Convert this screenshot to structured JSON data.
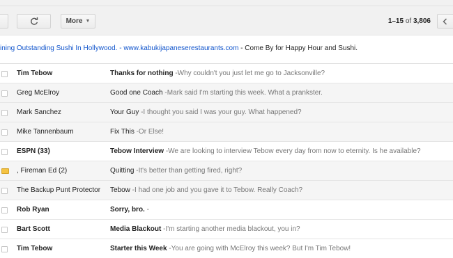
{
  "toolbar": {
    "more_label": "More",
    "pager_range": "1–15",
    "pager_of": " of ",
    "pager_total": "3,806"
  },
  "ad": {
    "text_link": "ining Outstanding Sushi In Hollywood. - www.kabukijapaneserestaurants.com",
    "text_tail": " - Come By for Happy Hour and Sushi."
  },
  "emails": [
    {
      "sender": "Tim Tebow",
      "subject": "Thanks for nothing",
      "snippet": " -Why couldn't you just let me go to Jacksonville?",
      "unread": true,
      "icon": "checkbox"
    },
    {
      "sender": "Greg McElroy",
      "subject": "Good one Coach",
      "snippet": " -Mark said I'm starting this week. What a prankster.",
      "unread": false,
      "icon": "checkbox"
    },
    {
      "sender": "Mark Sanchez",
      "subject": "Your Guy",
      "snippet": " -I thought you said I was your guy. What happened?",
      "unread": false,
      "icon": "checkbox"
    },
    {
      "sender": "Mike Tannenbaum",
      "subject": "Fix This",
      "snippet": " -Or Else!",
      "unread": false,
      "icon": "checkbox"
    },
    {
      "sender": "ESPN (33)",
      "subject": "Tebow Interview",
      "snippet": " -We are looking to interview Tebow every day from now to eternity. Is he available?",
      "unread": true,
      "icon": "checkbox"
    },
    {
      "sender": ", Fireman Ed (2)",
      "subject": "Quitting",
      "snippet": " -It's better than getting fired, right?",
      "unread": false,
      "icon": "folder"
    },
    {
      "sender": "The Backup Punt Protector",
      "subject": "Tebow",
      "snippet": " -I had one job and you gave it to Tebow. Really Coach?",
      "unread": false,
      "icon": "checkbox"
    },
    {
      "sender": "Rob Ryan",
      "subject": "Sorry, bro.",
      "snippet": " -",
      "unread": true,
      "icon": "checkbox"
    },
    {
      "sender": "Bart Scott",
      "subject": "Media Blackout",
      "snippet": " -I'm starting another media blackout, you in?",
      "unread": true,
      "icon": "checkbox"
    },
    {
      "sender": "Tim Tebow",
      "subject": "Starter this Week",
      "snippet": " -You are going with McElroy this week? But I'm Tim Tebow!",
      "unread": true,
      "icon": "checkbox"
    }
  ]
}
